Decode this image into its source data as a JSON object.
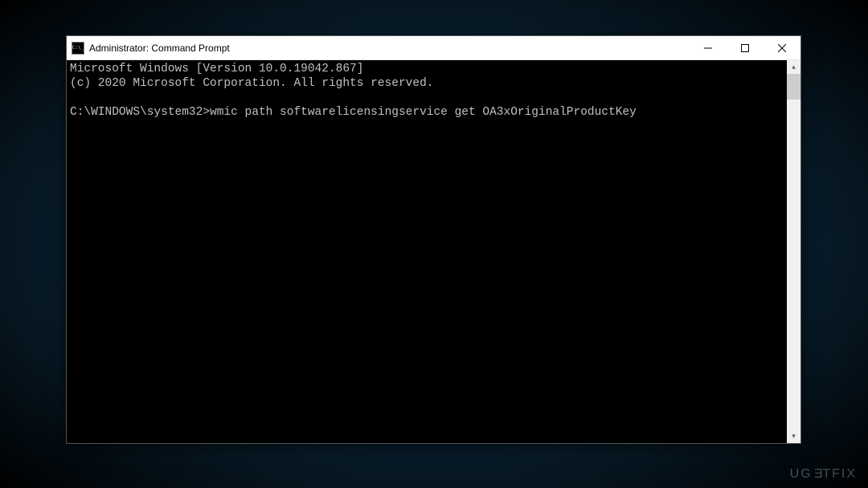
{
  "window": {
    "title": "Administrator: Command Prompt"
  },
  "console": {
    "line1": "Microsoft Windows [Version 10.0.19042.867]",
    "line2": "(c) 2020 Microsoft Corporation. All rights reserved.",
    "blank": "",
    "prompt": "C:\\WINDOWS\\system32>",
    "command": "wmic path softwarelicensingservice get OA3xOriginalProductKey"
  },
  "watermark": "UGETFIX"
}
